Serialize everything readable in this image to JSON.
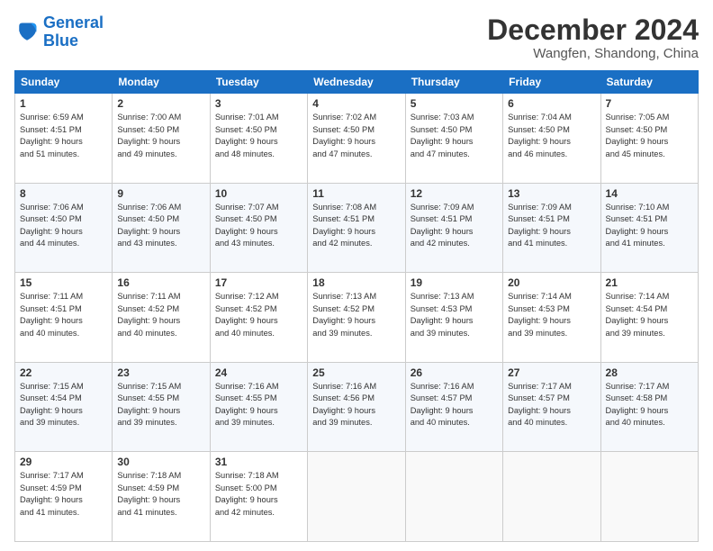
{
  "logo": {
    "line1": "General",
    "line2": "Blue"
  },
  "title": "December 2024",
  "location": "Wangfen, Shandong, China",
  "days_of_week": [
    "Sunday",
    "Monday",
    "Tuesday",
    "Wednesday",
    "Thursday",
    "Friday",
    "Saturday"
  ],
  "weeks": [
    [
      {
        "day": "1",
        "info": "Sunrise: 6:59 AM\nSunset: 4:51 PM\nDaylight: 9 hours\nand 51 minutes."
      },
      {
        "day": "2",
        "info": "Sunrise: 7:00 AM\nSunset: 4:50 PM\nDaylight: 9 hours\nand 49 minutes."
      },
      {
        "day": "3",
        "info": "Sunrise: 7:01 AM\nSunset: 4:50 PM\nDaylight: 9 hours\nand 48 minutes."
      },
      {
        "day": "4",
        "info": "Sunrise: 7:02 AM\nSunset: 4:50 PM\nDaylight: 9 hours\nand 47 minutes."
      },
      {
        "day": "5",
        "info": "Sunrise: 7:03 AM\nSunset: 4:50 PM\nDaylight: 9 hours\nand 47 minutes."
      },
      {
        "day": "6",
        "info": "Sunrise: 7:04 AM\nSunset: 4:50 PM\nDaylight: 9 hours\nand 46 minutes."
      },
      {
        "day": "7",
        "info": "Sunrise: 7:05 AM\nSunset: 4:50 PM\nDaylight: 9 hours\nand 45 minutes."
      }
    ],
    [
      {
        "day": "8",
        "info": "Sunrise: 7:06 AM\nSunset: 4:50 PM\nDaylight: 9 hours\nand 44 minutes."
      },
      {
        "day": "9",
        "info": "Sunrise: 7:06 AM\nSunset: 4:50 PM\nDaylight: 9 hours\nand 43 minutes."
      },
      {
        "day": "10",
        "info": "Sunrise: 7:07 AM\nSunset: 4:50 PM\nDaylight: 9 hours\nand 43 minutes."
      },
      {
        "day": "11",
        "info": "Sunrise: 7:08 AM\nSunset: 4:51 PM\nDaylight: 9 hours\nand 42 minutes."
      },
      {
        "day": "12",
        "info": "Sunrise: 7:09 AM\nSunset: 4:51 PM\nDaylight: 9 hours\nand 42 minutes."
      },
      {
        "day": "13",
        "info": "Sunrise: 7:09 AM\nSunset: 4:51 PM\nDaylight: 9 hours\nand 41 minutes."
      },
      {
        "day": "14",
        "info": "Sunrise: 7:10 AM\nSunset: 4:51 PM\nDaylight: 9 hours\nand 41 minutes."
      }
    ],
    [
      {
        "day": "15",
        "info": "Sunrise: 7:11 AM\nSunset: 4:51 PM\nDaylight: 9 hours\nand 40 minutes."
      },
      {
        "day": "16",
        "info": "Sunrise: 7:11 AM\nSunset: 4:52 PM\nDaylight: 9 hours\nand 40 minutes."
      },
      {
        "day": "17",
        "info": "Sunrise: 7:12 AM\nSunset: 4:52 PM\nDaylight: 9 hours\nand 40 minutes."
      },
      {
        "day": "18",
        "info": "Sunrise: 7:13 AM\nSunset: 4:52 PM\nDaylight: 9 hours\nand 39 minutes."
      },
      {
        "day": "19",
        "info": "Sunrise: 7:13 AM\nSunset: 4:53 PM\nDaylight: 9 hours\nand 39 minutes."
      },
      {
        "day": "20",
        "info": "Sunrise: 7:14 AM\nSunset: 4:53 PM\nDaylight: 9 hours\nand 39 minutes."
      },
      {
        "day": "21",
        "info": "Sunrise: 7:14 AM\nSunset: 4:54 PM\nDaylight: 9 hours\nand 39 minutes."
      }
    ],
    [
      {
        "day": "22",
        "info": "Sunrise: 7:15 AM\nSunset: 4:54 PM\nDaylight: 9 hours\nand 39 minutes."
      },
      {
        "day": "23",
        "info": "Sunrise: 7:15 AM\nSunset: 4:55 PM\nDaylight: 9 hours\nand 39 minutes."
      },
      {
        "day": "24",
        "info": "Sunrise: 7:16 AM\nSunset: 4:55 PM\nDaylight: 9 hours\nand 39 minutes."
      },
      {
        "day": "25",
        "info": "Sunrise: 7:16 AM\nSunset: 4:56 PM\nDaylight: 9 hours\nand 39 minutes."
      },
      {
        "day": "26",
        "info": "Sunrise: 7:16 AM\nSunset: 4:57 PM\nDaylight: 9 hours\nand 40 minutes."
      },
      {
        "day": "27",
        "info": "Sunrise: 7:17 AM\nSunset: 4:57 PM\nDaylight: 9 hours\nand 40 minutes."
      },
      {
        "day": "28",
        "info": "Sunrise: 7:17 AM\nSunset: 4:58 PM\nDaylight: 9 hours\nand 40 minutes."
      }
    ],
    [
      {
        "day": "29",
        "info": "Sunrise: 7:17 AM\nSunset: 4:59 PM\nDaylight: 9 hours\nand 41 minutes."
      },
      {
        "day": "30",
        "info": "Sunrise: 7:18 AM\nSunset: 4:59 PM\nDaylight: 9 hours\nand 41 minutes."
      },
      {
        "day": "31",
        "info": "Sunrise: 7:18 AM\nSunset: 5:00 PM\nDaylight: 9 hours\nand 42 minutes."
      },
      null,
      null,
      null,
      null
    ]
  ]
}
